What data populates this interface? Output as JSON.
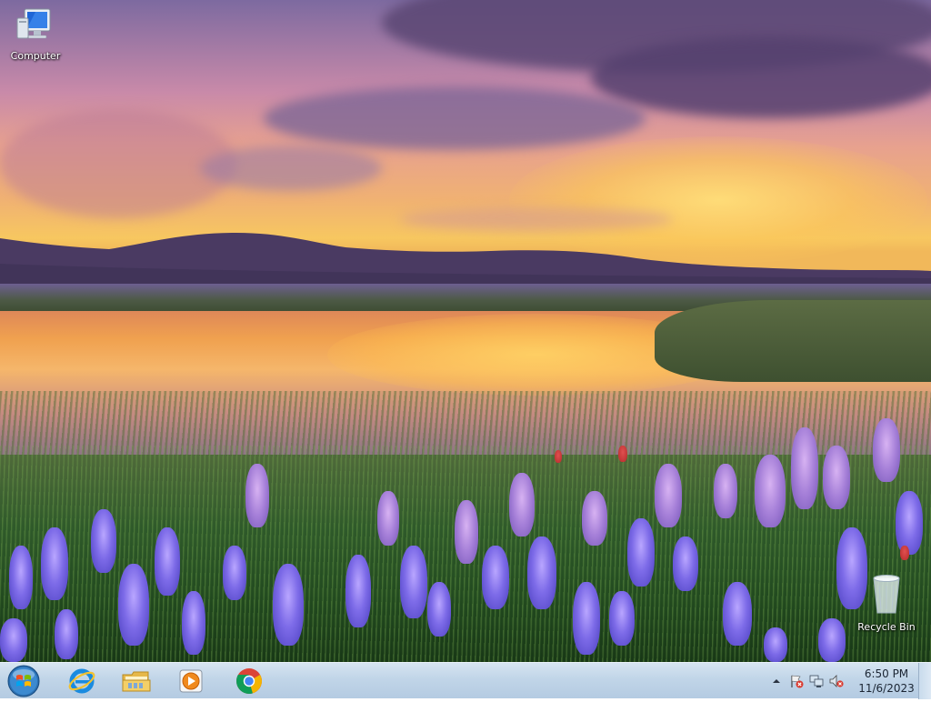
{
  "desktop": {
    "icons": [
      {
        "label": "Computer",
        "icon": "computer-icon"
      },
      {
        "label": "Recycle Bin",
        "icon": "recycle-bin-icon"
      }
    ]
  },
  "taskbar": {
    "start": {
      "icon": "windows-logo-icon"
    },
    "pinned": [
      {
        "name": "Internet Explorer",
        "icon": "internet-explorer-icon"
      },
      {
        "name": "Windows Explorer",
        "icon": "file-explorer-icon"
      },
      {
        "name": "Windows Media Player",
        "icon": "media-player-icon"
      },
      {
        "name": "Google Chrome",
        "icon": "chrome-icon"
      }
    ],
    "tray": {
      "icons": [
        "show-hidden-icons-arrow",
        "action-center-flag-icon",
        "network-icon",
        "volume-muted-icon"
      ],
      "time": "6:50 PM",
      "date": "11/6/2023"
    }
  },
  "colors": {
    "taskbar_top": "#d6e4f1",
    "taskbar_bottom": "#b4cbe2",
    "label_text": "#ffffff",
    "clock_text": "#1b2533"
  }
}
